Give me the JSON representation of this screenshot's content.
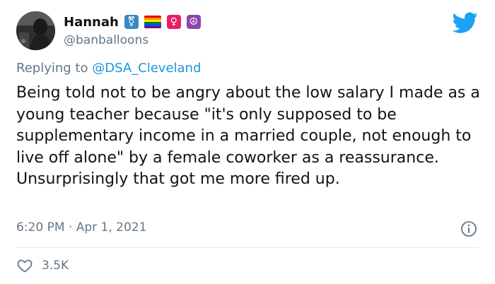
{
  "tweet": {
    "display_name": "Hannah",
    "handle": "@banballoons",
    "reply_prefix": "Replying to",
    "reply_to": "@DSA_Cleveland",
    "text": "Being told not to be angry about the low salary I made as a young teacher because \"it's only supposed to be supplementary income in a married couple, not enough to live off alone\" by a female coworker as a reassurance. Unsurprisingly that got me more fired up.",
    "timestamp": "6:20 PM · Apr 1, 2021",
    "likes": "3.5K"
  },
  "name_emojis": [
    {
      "icon": "trans-gender-symbol-icon",
      "glyph": "⚧",
      "bg": "#3b88c3"
    },
    {
      "icon": "rainbow-flag-icon"
    },
    {
      "icon": "female-sign-icon",
      "glyph": "♀",
      "bg": "#e91e63"
    },
    {
      "icon": "peace-symbol-icon",
      "glyph": "☮",
      "bg": "#8e44ad"
    }
  ],
  "colors": {
    "twitter_blue": "#1da1f2",
    "link": "#1b95e0",
    "secondary_text": "#657786",
    "text": "#0f1419",
    "divider": "#e1e8ed"
  }
}
